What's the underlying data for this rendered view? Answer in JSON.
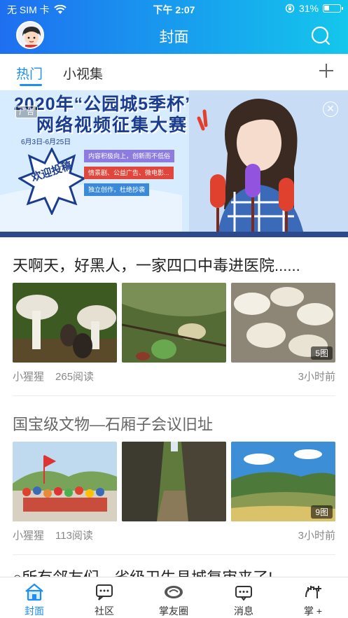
{
  "status_bar": {
    "carrier": "无 SIM 卡",
    "time": "下午 2:07",
    "battery": "31%"
  },
  "nav": {
    "title": "封面"
  },
  "tabs": [
    {
      "label": "热门",
      "active": true
    },
    {
      "label": "小视集",
      "active": false
    }
  ],
  "banner": {
    "ad_tag": "广告",
    "title_line1": "2020年“公园城5季杯”",
    "title_line2": "网络视频征集大赛",
    "date": "6月3日-6月25日",
    "welcome": "欢迎投稿",
    "bullets": [
      "内容积极向上，创新而不低俗",
      "情景剧、公益广告、微电影...",
      "独立创作，杜绝抄袭"
    ]
  },
  "articles": [
    {
      "title": "天啊天，好黑人，一家四口中毒进医院......",
      "author": "小猩猩",
      "reads": "265阅读",
      "time": "3小时前",
      "image_count": "5图"
    },
    {
      "title": "国宝级文物—石厢子会议旧址",
      "author": "小猩猩",
      "reads": "113阅读",
      "time": "3小时前",
      "image_count": "9图"
    },
    {
      "title": "○所有邻友们，省级卫生县城复审来了!"
    }
  ],
  "tabbar": [
    {
      "label": "封面",
      "icon": "home-icon",
      "active": true
    },
    {
      "label": "社区",
      "icon": "community-icon",
      "active": false
    },
    {
      "label": "掌友圈",
      "icon": "friends-circle-icon",
      "active": false
    },
    {
      "label": "消息",
      "icon": "message-icon",
      "active": false
    },
    {
      "label": "掌 +",
      "icon": "zhang-plus-icon",
      "active": false
    }
  ],
  "colors": {
    "accent": "#1e8ff0",
    "header_start": "#1e6ff0",
    "header_end": "#14c7ec"
  }
}
